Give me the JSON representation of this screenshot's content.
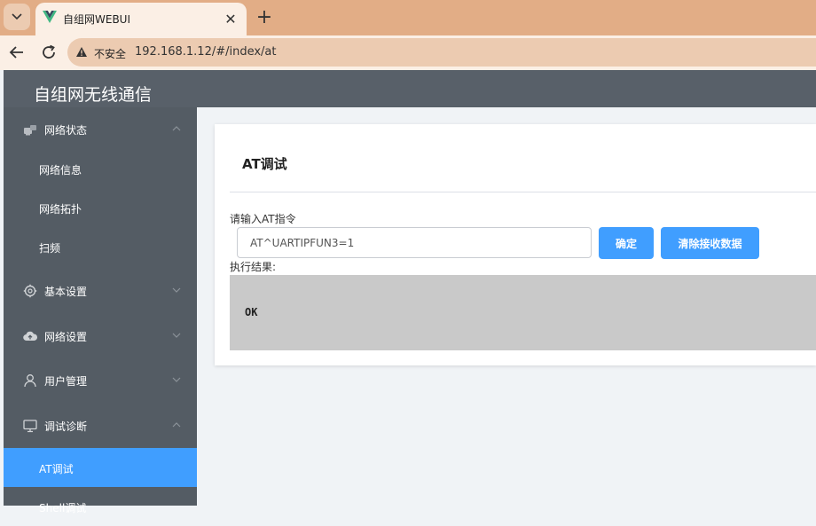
{
  "browser": {
    "tab_title": "自组网WEBUI",
    "insecure_label": "不安全",
    "url": "192.168.1.12/#/index/at"
  },
  "app": {
    "title": "自组网无线通信"
  },
  "sidebar": {
    "groups": [
      {
        "label": "网络状态",
        "icon": "network-status-icon",
        "expanded": true
      },
      {
        "label": "基本设置",
        "icon": "gear-icon",
        "expanded": false
      },
      {
        "label": "网络设置",
        "icon": "cloud-upload-icon",
        "expanded": false
      },
      {
        "label": "用户管理",
        "icon": "user-icon",
        "expanded": false
      },
      {
        "label": "调试诊断",
        "icon": "monitor-icon",
        "expanded": true
      }
    ],
    "status_items": [
      {
        "label": "网络信息"
      },
      {
        "label": "网络拓扑"
      },
      {
        "label": "扫频"
      }
    ],
    "debug_items": [
      {
        "label": "AT调试",
        "active": true
      },
      {
        "label": "Shell调试"
      }
    ]
  },
  "at_page": {
    "title": "AT调试",
    "input_label": "请输入AT指令",
    "input_value": "AT^UARTIPFUN3=1",
    "confirm_label": "确定",
    "clear_label": "清除接收数据",
    "result_label": "执行结果:",
    "result_text": "OK"
  },
  "colors": {
    "sidebar_bg": "#545c64",
    "header_bg": "#586069",
    "accent": "#409eff",
    "result_bg": "#c9c9c9",
    "browser_frame": "#e2ad86"
  }
}
